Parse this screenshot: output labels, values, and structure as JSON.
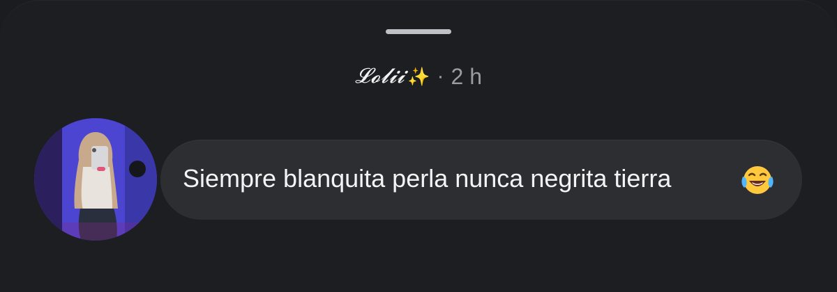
{
  "header": {
    "username": "𝓛𝓸𝓵𝓲𝓲",
    "separator": "·",
    "time": "2 h"
  },
  "message": {
    "text": "Siempre blanquita perla nunca negrita tierra"
  },
  "icons": {
    "sparkles": "sparkles-icon",
    "emoji": "face-with-tears-of-joy-icon"
  }
}
